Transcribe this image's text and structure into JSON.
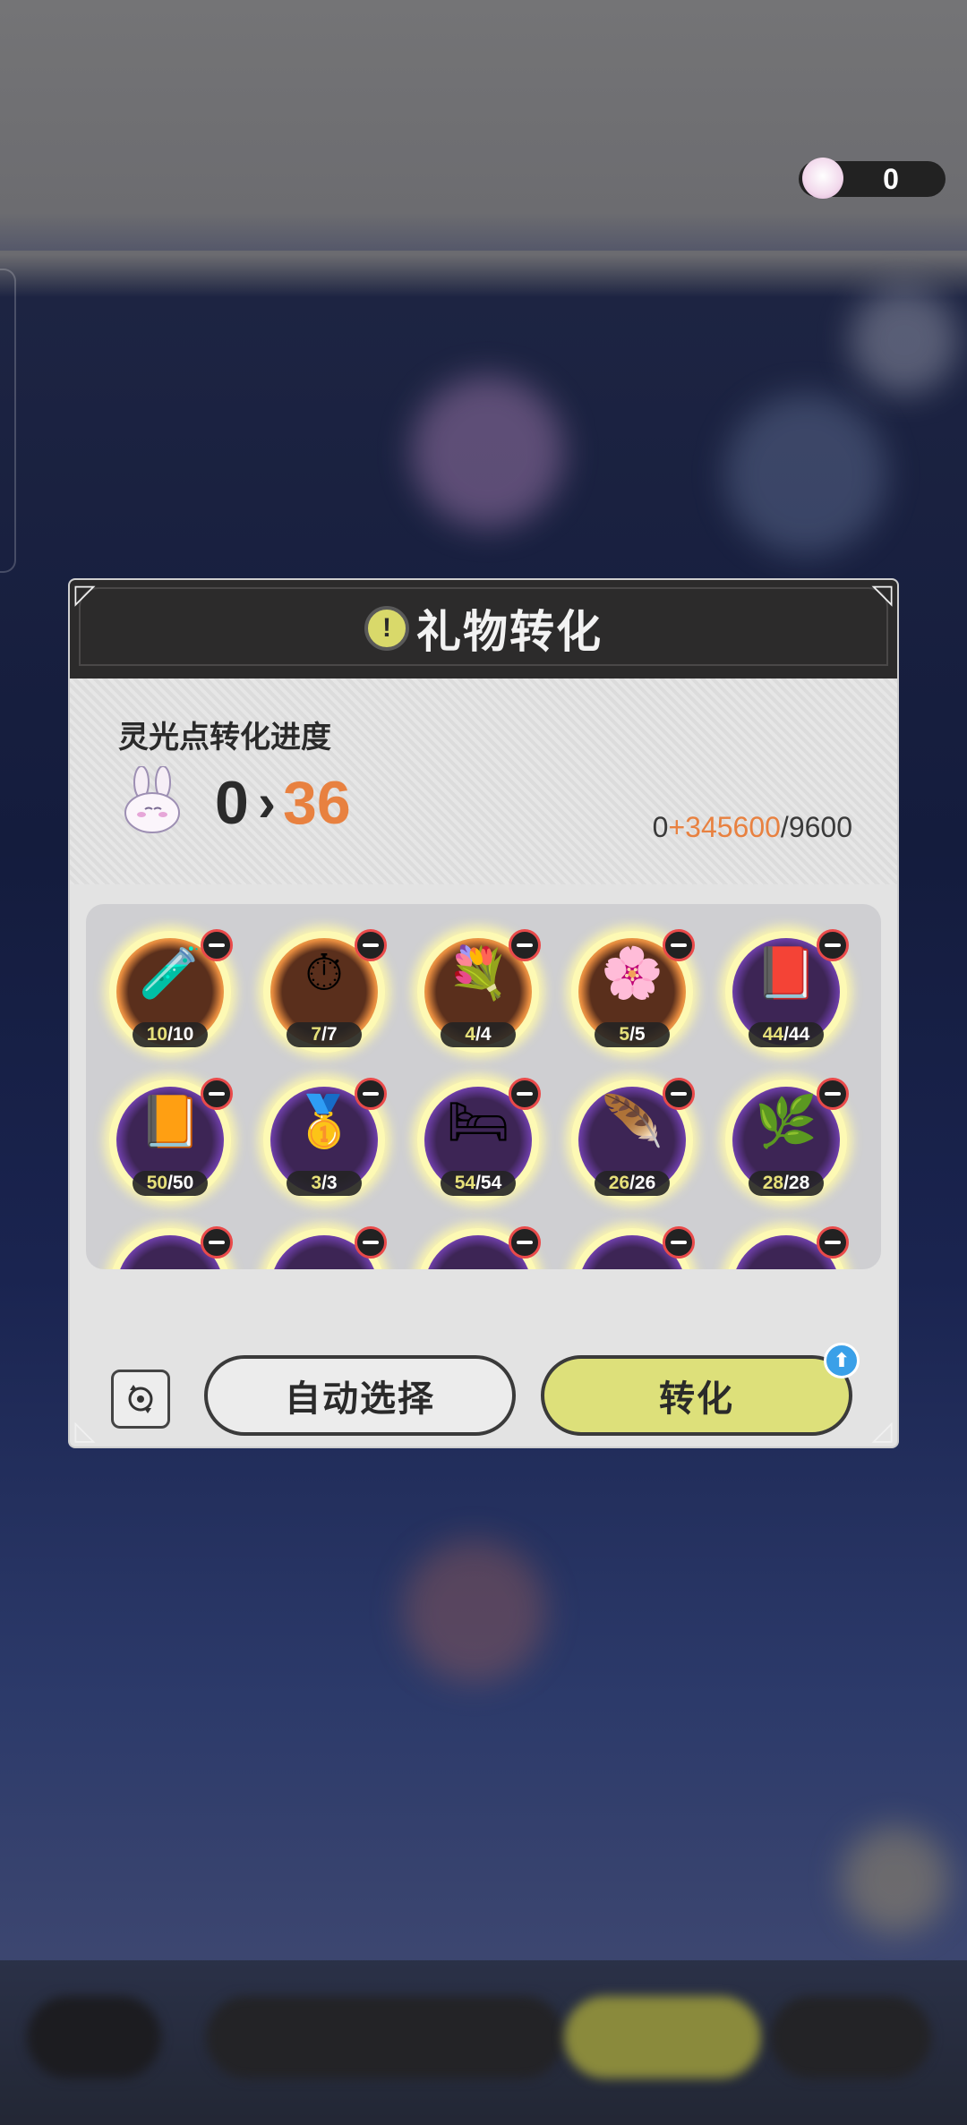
{
  "currency": {
    "value": "0",
    "icon": "rabbit-icon"
  },
  "modal": {
    "title": "礼物转化",
    "title_icon": "exclamation-icon",
    "progress_label": "灵光点转化进度",
    "level_from": "0",
    "level_to": "36",
    "points_current": "0",
    "points_add": "+345600",
    "points_max": "/9600",
    "progress_fill": 0.0
  },
  "items": [
    {
      "icon": "potion-icon",
      "glyph": "🧪",
      "have": "10",
      "total": "/10",
      "style": "orange"
    },
    {
      "icon": "pocket-watch-icon",
      "glyph": "⏱",
      "have": "7",
      "total": "/7",
      "style": "orange"
    },
    {
      "icon": "purple-flowers-icon",
      "glyph": "💐",
      "have": "4",
      "total": "/4",
      "style": "orange"
    },
    {
      "icon": "pink-flowers-icon",
      "glyph": "🌸",
      "have": "5",
      "total": "/5",
      "style": "orange"
    },
    {
      "icon": "book-icon",
      "glyph": "📕",
      "have": "44",
      "total": "/44",
      "style": "purple"
    },
    {
      "icon": "card-book-icon",
      "glyph": "📙",
      "have": "50",
      "total": "/50",
      "style": "purple"
    },
    {
      "icon": "gold-ingot-icon",
      "glyph": "🥇",
      "have": "3",
      "total": "/3",
      "style": "purple"
    },
    {
      "icon": "pillow-icon",
      "glyph": "🛏",
      "have": "54",
      "total": "/54",
      "style": "purple"
    },
    {
      "icon": "quill-icon",
      "glyph": "🪶",
      "have": "26",
      "total": "/26",
      "style": "purple"
    },
    {
      "icon": "green-bouquet-icon",
      "glyph": "🌿",
      "have": "28",
      "total": "/28",
      "style": "purple"
    }
  ],
  "buttons": {
    "reset_icon": "reset-icon",
    "auto_select": "自动选择",
    "convert": "转化",
    "badge_icon": "arrow-up-icon",
    "badge_glyph": "⬆"
  }
}
